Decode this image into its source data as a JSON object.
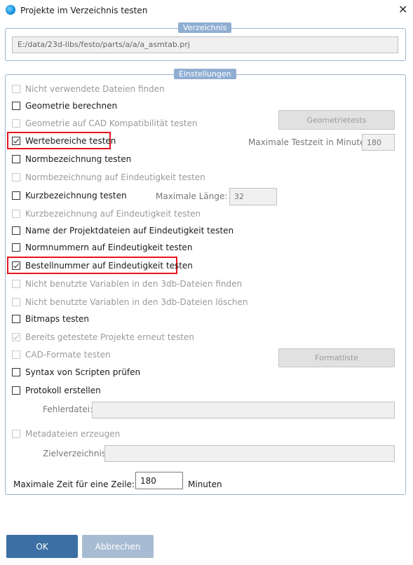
{
  "window": {
    "title": "Projekte im Verzeichnis testen",
    "close_label": "✕"
  },
  "verzeichnis": {
    "legend": "Verzeichnis",
    "path": "E:/data/23d-libs/festo/parts/a/a/a_asmtab.prj"
  },
  "einstellungen": {
    "legend": "Einstellungen",
    "options": {
      "nicht_verwendete": {
        "label": "Nicht verwendete Dateien finden",
        "checked": false,
        "enabled": false
      },
      "geometrie_berechnen": {
        "label": "Geometrie berechnen",
        "checked": false,
        "enabled": true
      },
      "geometrie_cad": {
        "label": "Geometrie auf CAD Kompatibilität testen",
        "checked": false,
        "enabled": false
      },
      "wertebereiche": {
        "label": "Wertebereiche testen",
        "checked": true,
        "enabled": true,
        "highlighted": true
      },
      "normbezeichnung": {
        "label": "Normbezeichnung testen",
        "checked": false,
        "enabled": true
      },
      "normbezeichnung_eind": {
        "label": "Normbezeichnung auf Eindeutigkeit testen",
        "checked": false,
        "enabled": false
      },
      "kurzbezeichnung": {
        "label": "Kurzbezeichnung testen",
        "checked": false,
        "enabled": true
      },
      "kurzbezeichnung_eind": {
        "label": "Kurzbezeichnung auf Eindeutigkeit testen",
        "checked": false,
        "enabled": false
      },
      "name_projektdateien": {
        "label": "Name der Projektdateien auf Eindeutigkeit testen",
        "checked": false,
        "enabled": true
      },
      "normnummern": {
        "label": "Normnummern auf Eindeutigkeit testen",
        "checked": false,
        "enabled": true
      },
      "bestellnummer": {
        "label": "Bestellnummer auf Eindeutigkeit testen",
        "checked": true,
        "enabled": true,
        "highlighted": true
      },
      "variablen_finden": {
        "label": "Nicht benutzte Variablen in den 3db-Dateien finden",
        "checked": false,
        "enabled": false
      },
      "variablen_loeschen": {
        "label": "Nicht benutzte Variablen in den 3db-Dateien löschen",
        "checked": false,
        "enabled": false
      },
      "bitmaps": {
        "label": "Bitmaps testen",
        "checked": false,
        "enabled": true
      },
      "bereits_getestete": {
        "label": "Bereits getestete Projekte erneut testen",
        "checked": true,
        "enabled": false
      },
      "cad_formate": {
        "label": "CAD-Formate testen",
        "checked": false,
        "enabled": false
      },
      "syntax": {
        "label": "Syntax von Scripten prüfen",
        "checked": false,
        "enabled": true
      },
      "protokoll": {
        "label": "Protokoll erstellen",
        "checked": false,
        "enabled": true
      },
      "metadateien": {
        "label": "Metadateien erzeugen",
        "checked": false,
        "enabled": false
      }
    },
    "geometrietests_button": "Geometrietests",
    "max_testzeit_label": "Maximale Testzeit in Minuten:",
    "max_testzeit_value": "180",
    "max_laenge_label": "Maximale Länge:",
    "max_laenge_value": "32",
    "formatliste_button": "Formatliste",
    "fehlerdatei_label": "Fehlerdatei:",
    "fehlerdatei_value": "",
    "zielverzeichnis_label": "Zielverzeichnis:",
    "zielverzeichnis_value": "",
    "max_zeit_label": "Maximale Zeit für eine Zeile:",
    "max_zeit_value": "180",
    "minuten_label": "Minuten"
  },
  "footer": {
    "ok_label": "OK",
    "cancel_label": "Abbrechen"
  },
  "colors": {
    "accent": "#3c6fa3",
    "legend_bg": "#90aed2",
    "highlight": "#e8131b"
  },
  "icons": {
    "app": "app-globe-icon",
    "close": "close-icon",
    "checkbox_checked": "checkmark-icon"
  }
}
